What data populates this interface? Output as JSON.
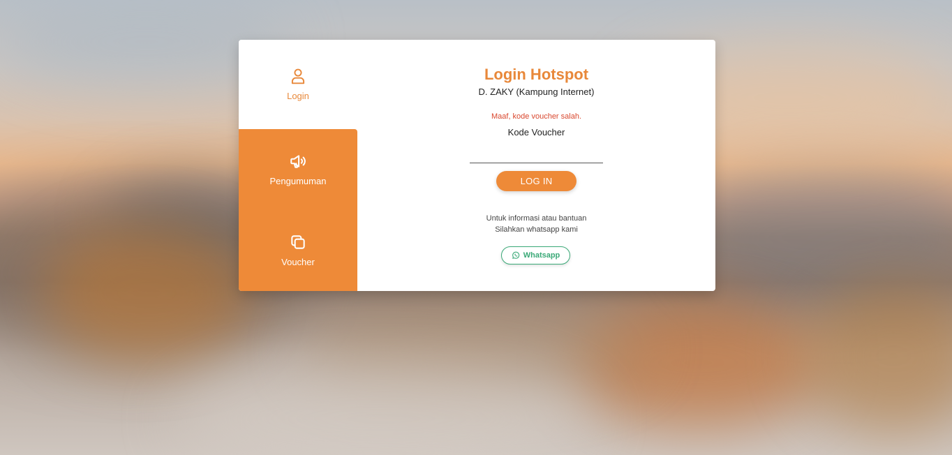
{
  "theme": {
    "accent": "#ee8a38",
    "accent_text": "#e8883a",
    "error": "#d9472e",
    "whatsapp_green": "#3aa977"
  },
  "nav": {
    "items": [
      {
        "label": "Login",
        "icon": "user-icon",
        "active": true
      },
      {
        "label": "Pengumuman",
        "icon": "megaphone-icon",
        "active": false
      },
      {
        "label": "Voucher",
        "icon": "copy-icon",
        "active": false
      }
    ]
  },
  "login": {
    "title": "Login Hotspot",
    "subtitle": "D. ZAKY (Kampung Internet)",
    "error_message": "Maaf, kode voucher salah.",
    "field_label": "Kode Voucher",
    "voucher_value": "",
    "button_label": "LOG IN",
    "info_line1": "Untuk informasi atau bantuan",
    "info_line2": "Silahkan whatsapp kami",
    "whatsapp_label": "Whatsapp",
    "whatsapp_icon": "whatsapp-icon"
  }
}
